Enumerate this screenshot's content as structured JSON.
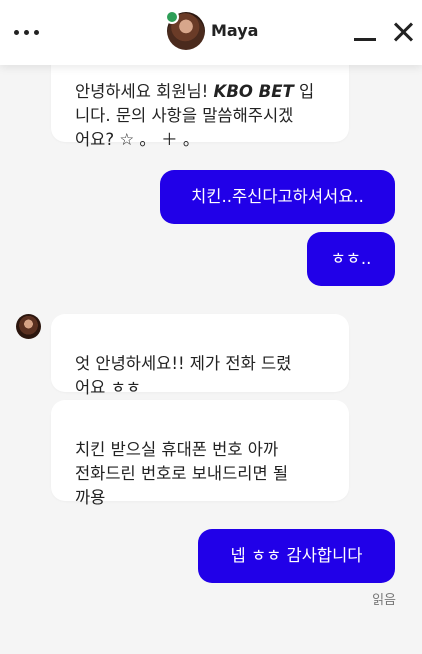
{
  "header": {
    "name": "Maya"
  },
  "messages": {
    "m1": "안녕하세요 회원님! KBO BET 입\n니다. 문의 사항을 말씀해주시겠\n어요? ☆ 。 ＋ 。",
    "m1_top": "안녕하세요 회원님! ",
    "m1_brand": "KBO BET",
    "m1_rest": " 입\n니다. 문의 사항을 말씀해주시겠\n어요? ☆ 。 ＋ 。",
    "m2": "치킨..주신다고하셔서요..",
    "m3": "ㅎㅎ..",
    "m4": "엇 안녕하세요!! 제가 전화 드렸\n어요 ㅎㅎ",
    "m5": "치킨 받으실 휴대폰 번호 아까\n전화드린 번호로 보내드리면 될\n까용",
    "m6": "넵 ㅎㅎ 감사합니다"
  },
  "status": {
    "read": "읽음"
  },
  "colors": {
    "outgoing_bubble": "#2100e8",
    "incoming_bubble": "#ffffff",
    "online": "#2e9e57"
  }
}
